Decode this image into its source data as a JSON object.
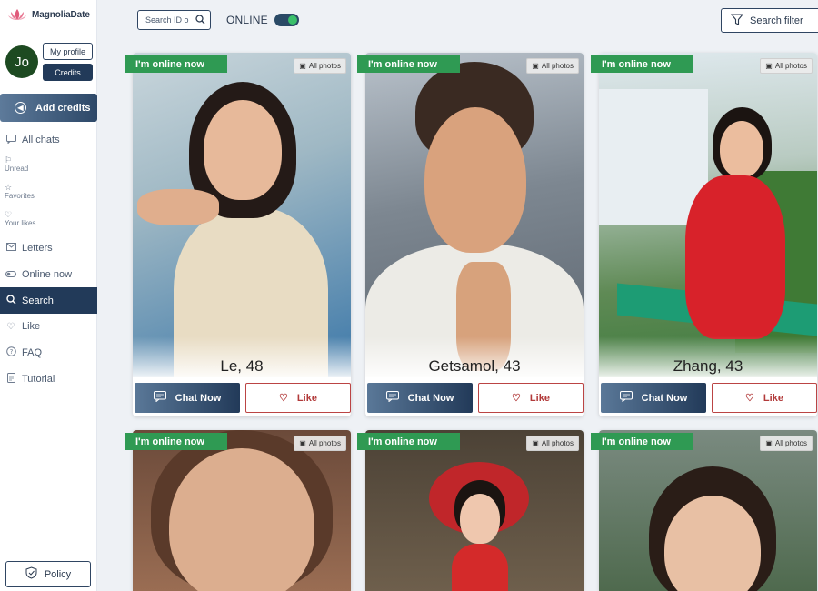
{
  "app": {
    "brand": "MagnoliaDate"
  },
  "profile": {
    "initials": "Jo",
    "my_profile_label": "My profile",
    "credits_label": "Credits"
  },
  "sidebar": {
    "add_credits": "Add credits",
    "items": [
      {
        "label": "All chats",
        "icon": "chat-bubble-icon"
      },
      {
        "label": "Unread",
        "icon": "flag-icon"
      },
      {
        "label": "Favorites",
        "icon": "star-icon"
      },
      {
        "label": "Your likes",
        "icon": "heart-icon"
      },
      {
        "label": "Letters",
        "icon": "envelope-icon"
      },
      {
        "label": "Online now",
        "icon": "toggle-icon"
      },
      {
        "label": "Search",
        "icon": "search-icon"
      },
      {
        "label": "Like",
        "icon": "heart-icon"
      },
      {
        "label": "FAQ",
        "icon": "question-icon"
      },
      {
        "label": "Tutorial",
        "icon": "document-icon"
      }
    ],
    "active": "Search",
    "policy": "Policy"
  },
  "topbar": {
    "search_placeholder": "Search ID or name",
    "online_label": "ONLINE",
    "online_toggle": true,
    "filter_label": "Search filter"
  },
  "cards": [
    {
      "name_age": "Le, 48",
      "online_badge": "I'm online now",
      "photos_label": "All photos",
      "chat_label": "Chat Now",
      "like_label": "Like"
    },
    {
      "name_age": "Getsamol, 43",
      "online_badge": "I'm online now",
      "photos_label": "All photos",
      "chat_label": "Chat Now",
      "like_label": "Like"
    },
    {
      "name_age": "Zhang, 43",
      "online_badge": "I'm online now",
      "photos_label": "All photos",
      "chat_label": "Chat Now",
      "like_label": "Like"
    },
    {
      "name_age": "",
      "online_badge": "I'm online now",
      "photos_label": "All photos"
    },
    {
      "name_age": "",
      "online_badge": "I'm online now",
      "photos_label": "All photos"
    },
    {
      "name_age": "",
      "online_badge": "I'm online now",
      "photos_label": "All photos"
    }
  ],
  "colors": {
    "navy": "#223a59",
    "online_green": "#2f9a53",
    "like_red": "#b23a3a"
  }
}
